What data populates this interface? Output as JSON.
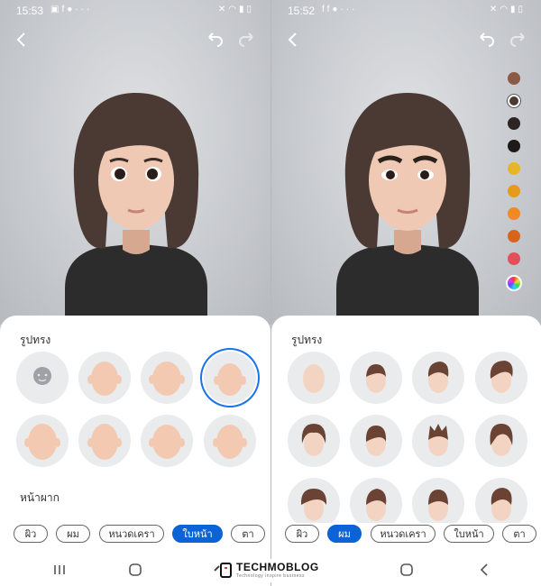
{
  "colors": {
    "accent": "#0b63d6",
    "selected_ring": "#1a73e8",
    "hair": "#4a3a33",
    "sweater": "#2c2c2c"
  },
  "left": {
    "status": {
      "time": "15:53",
      "left_icons": [
        "gallery-icon",
        "facebook-icon",
        "app-icon",
        "more-icon"
      ],
      "right_icons": [
        "mute-icon",
        "wifi-icon",
        "signal-icon",
        "battery-icon"
      ]
    },
    "section_title": "รูปทรง",
    "section2_title": "หน้าผาก",
    "tabs": [
      "ผิว",
      "ผม",
      "หนวดเครา",
      "ใบหน้า",
      "ตา"
    ],
    "active_tab": "ใบหน้า"
  },
  "right": {
    "status": {
      "time": "15:52",
      "left_icons": [
        "facebook-icon",
        "facebook-icon",
        "app-icon",
        "more-icon"
      ],
      "right_icons": [
        "mute-icon",
        "wifi-icon",
        "signal-icon",
        "battery-icon"
      ]
    },
    "section_title": "รูปทรง",
    "tabs": [
      "ผิว",
      "ผม",
      "หนวดเครา",
      "ใบหน้า",
      "ตา"
    ],
    "active_tab": "ผม",
    "hair_swatches": [
      "#8b5a44",
      "#4a3a33",
      "#2e2522",
      "#1f1a18",
      "#e6b52a",
      "#e89a1e",
      "#f08a24",
      "#d8641c",
      "#e3505a",
      "rainbow"
    ]
  },
  "watermark": {
    "name": "TECHMOBLOG",
    "tagline": "Technology inspire business"
  }
}
